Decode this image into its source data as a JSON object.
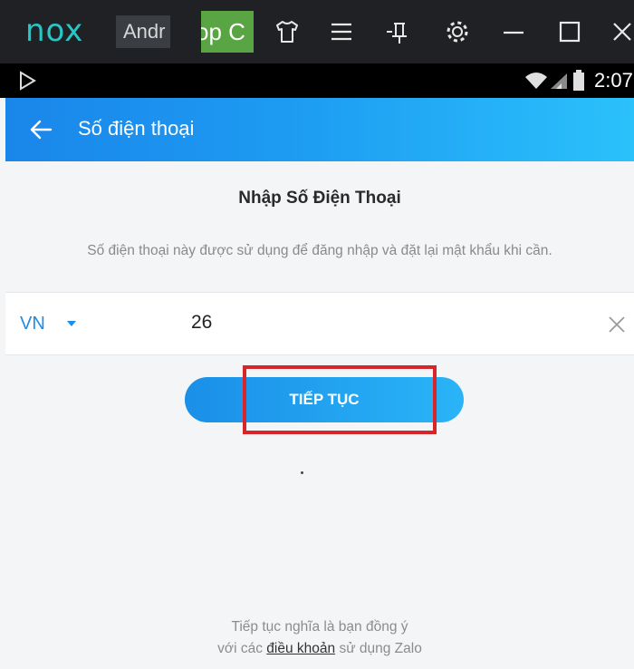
{
  "emulator": {
    "logo": "nox",
    "tab1_label": "Andr",
    "tab2_label": "op C",
    "toolbar_icons": [
      "shirt-icon",
      "menu-icon",
      "pin-icon",
      "gear-icon",
      "minimize-icon",
      "maximize-icon",
      "close-icon"
    ]
  },
  "status_bar": {
    "time": "2:07"
  },
  "app_bar": {
    "title": "Số điện thoại"
  },
  "form": {
    "heading": "Nhập Số Điện Thoại",
    "description": "Số điện thoại này được sử dụng để đăng nhập và đặt lại mật khẩu khi cần.",
    "country_code": "VN",
    "phone_value": "26",
    "continue_label": "TIẾP TỤC"
  },
  "terms": {
    "line1": "Tiếp tục nghĩa là bạn đồng ý",
    "line2_prefix": "với các",
    "link": "điều khoản",
    "line2_suffix": "sử dụng Zalo"
  },
  "colors": {
    "accent": "#1d8de8",
    "highlight": "#d6262a",
    "nox_teal": "#28c7c7"
  }
}
